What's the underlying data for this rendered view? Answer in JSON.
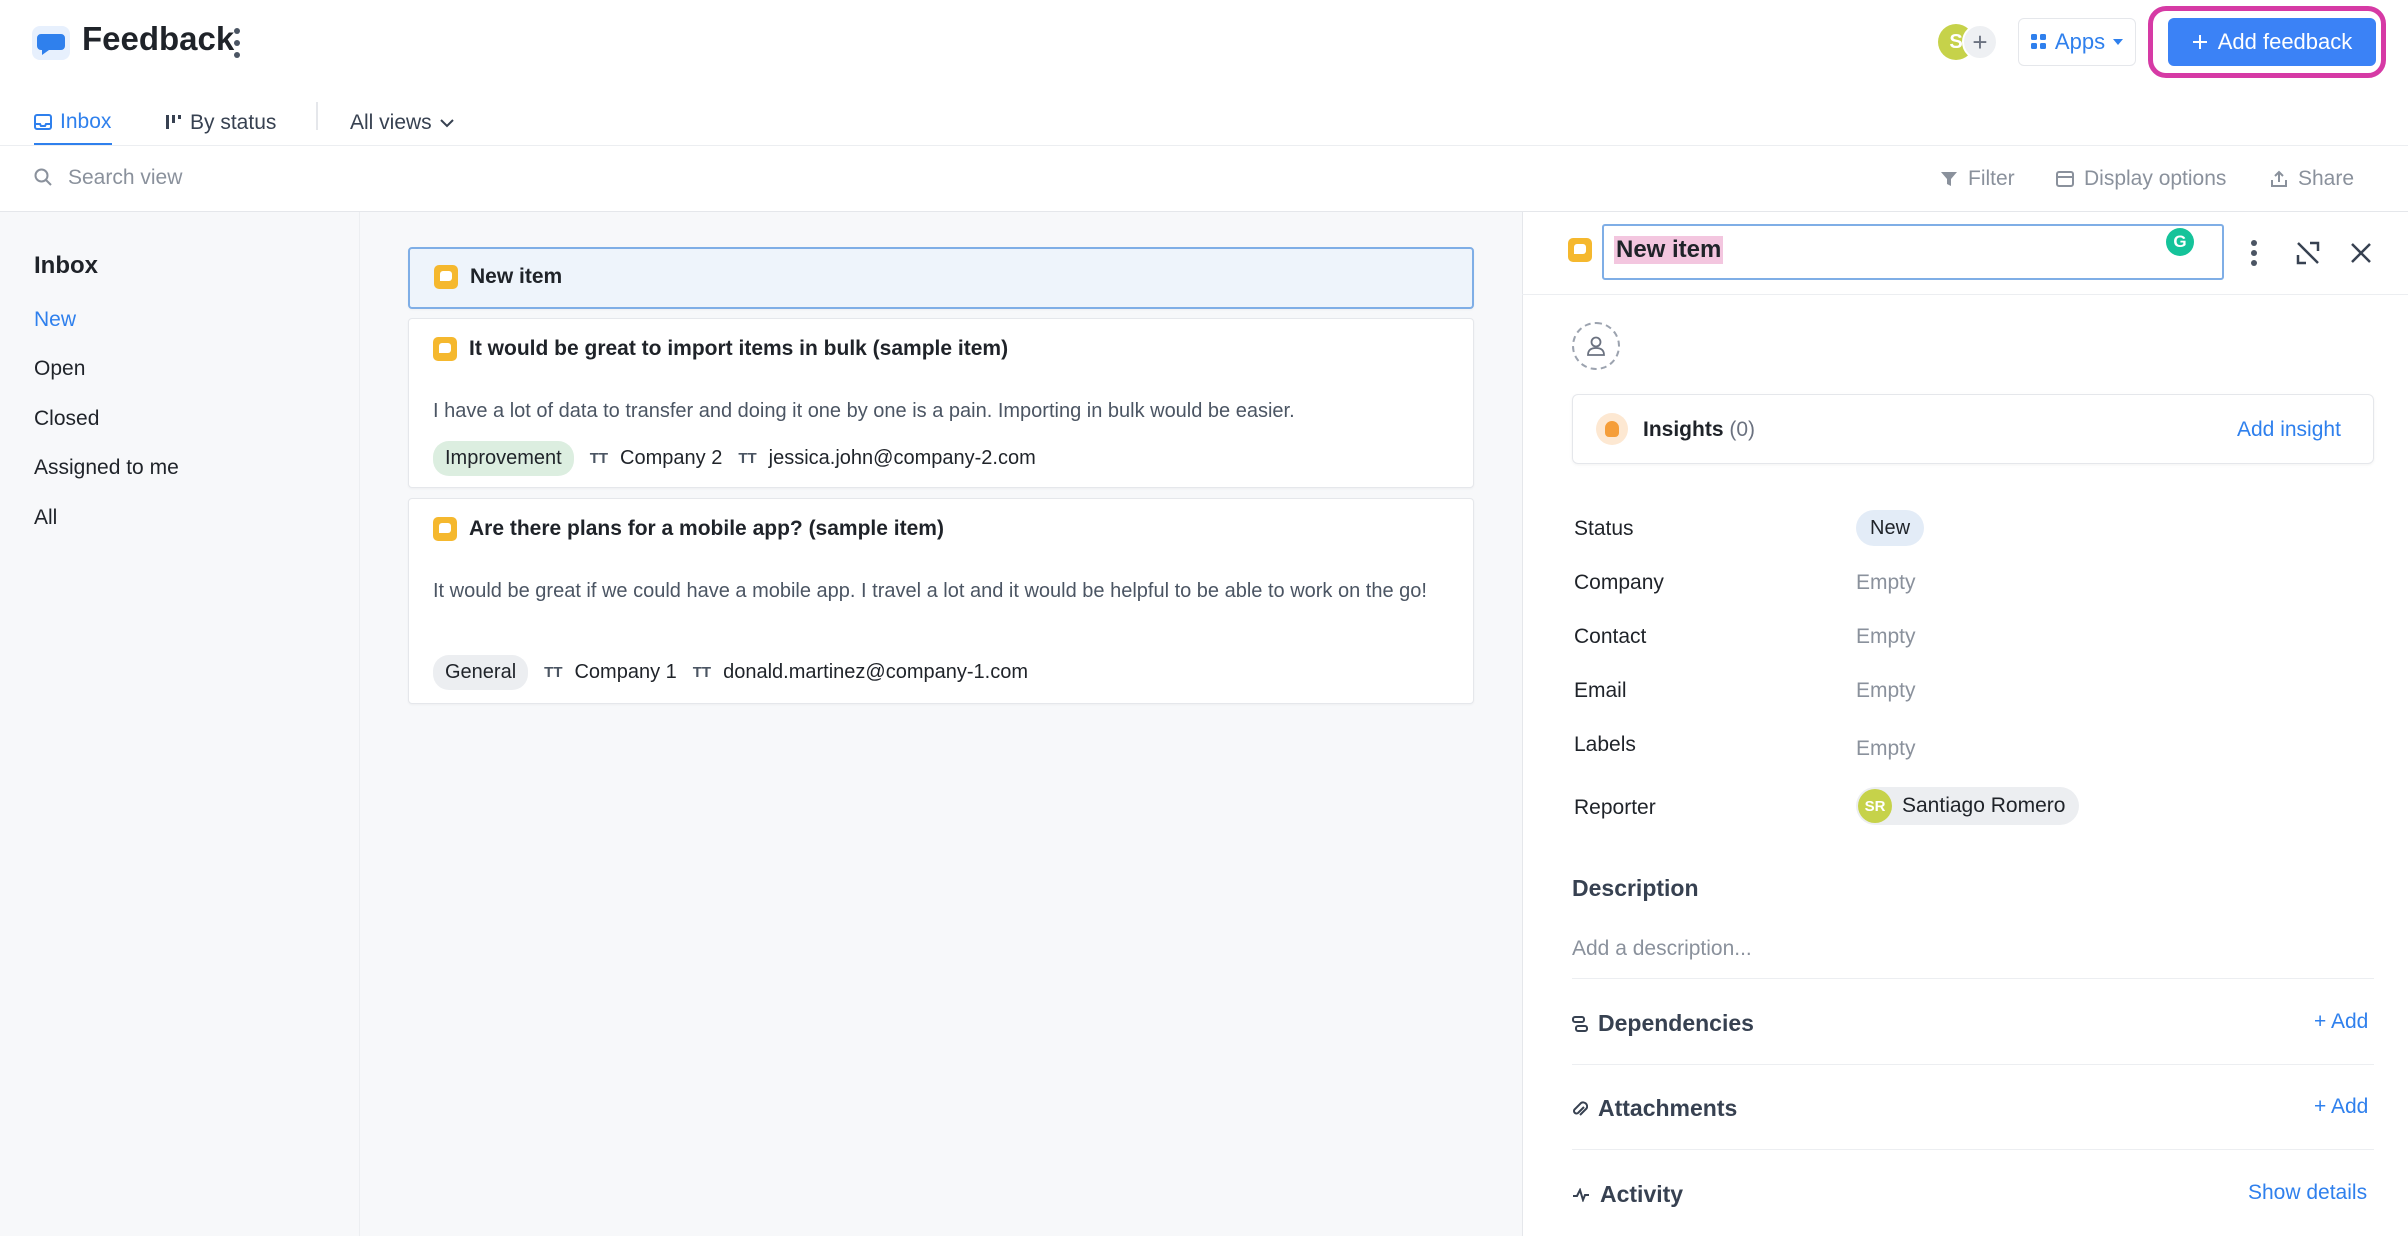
{
  "app": {
    "title": "Feedback",
    "avatar_initial": "S"
  },
  "header": {
    "apps_label": "Apps",
    "add_feedback_label": "Add feedback"
  },
  "tabs": [
    {
      "label": "Inbox",
      "active": true
    },
    {
      "label": "By status",
      "active": false
    },
    {
      "label": "All views",
      "active": false
    }
  ],
  "search": {
    "placeholder": "Search view"
  },
  "toolbar": {
    "filter": "Filter",
    "display_options": "Display options",
    "share": "Share"
  },
  "sidebar": {
    "title": "Inbox",
    "items": [
      {
        "label": "New",
        "active": true
      },
      {
        "label": "Open",
        "active": false
      },
      {
        "label": "Closed",
        "active": false
      },
      {
        "label": "Assigned to me",
        "active": false
      },
      {
        "label": "All",
        "active": false
      }
    ]
  },
  "items": [
    {
      "title": "New item"
    },
    {
      "title": "It would be great to import items in bulk (sample item)",
      "description": "I have a lot of data to transfer and doing it one by one is a pain. Importing in bulk would be easier.",
      "tag": "Improvement",
      "company": "Company 2",
      "email": "jessica.john@company-2.com"
    },
    {
      "title": "Are there plans for a mobile app? (sample item)",
      "description": "It would be great if we could have a mobile app. I travel a lot and it would be helpful to be able to work on the go!",
      "tag": "General",
      "company": "Company 1",
      "email": "donald.martinez@company-1.com"
    }
  ],
  "detail": {
    "title": "New item",
    "grammarly": "G",
    "insights_label": "Insights",
    "insights_count": "(0)",
    "add_insight": "Add insight",
    "fields": {
      "status_label": "Status",
      "status_value": "New",
      "company_label": "Company",
      "company_value": "Empty",
      "contact_label": "Contact",
      "contact_value": "Empty",
      "email_label": "Email",
      "email_value": "Empty",
      "labels_label": "Labels",
      "labels_value": "Empty",
      "reporter_label": "Reporter",
      "reporter_initials": "SR",
      "reporter_name": "Santiago Romero"
    },
    "description_heading": "Description",
    "description_placeholder": "Add a description...",
    "dependencies": "Dependencies",
    "attachments": "Attachments",
    "activity": "Activity",
    "add_link": "+ Add",
    "show_details": "Show details"
  },
  "colors": {
    "accent": "#3b82f6",
    "highlight_outline": "#d63aa5",
    "item_badge": "#f5b82e"
  }
}
